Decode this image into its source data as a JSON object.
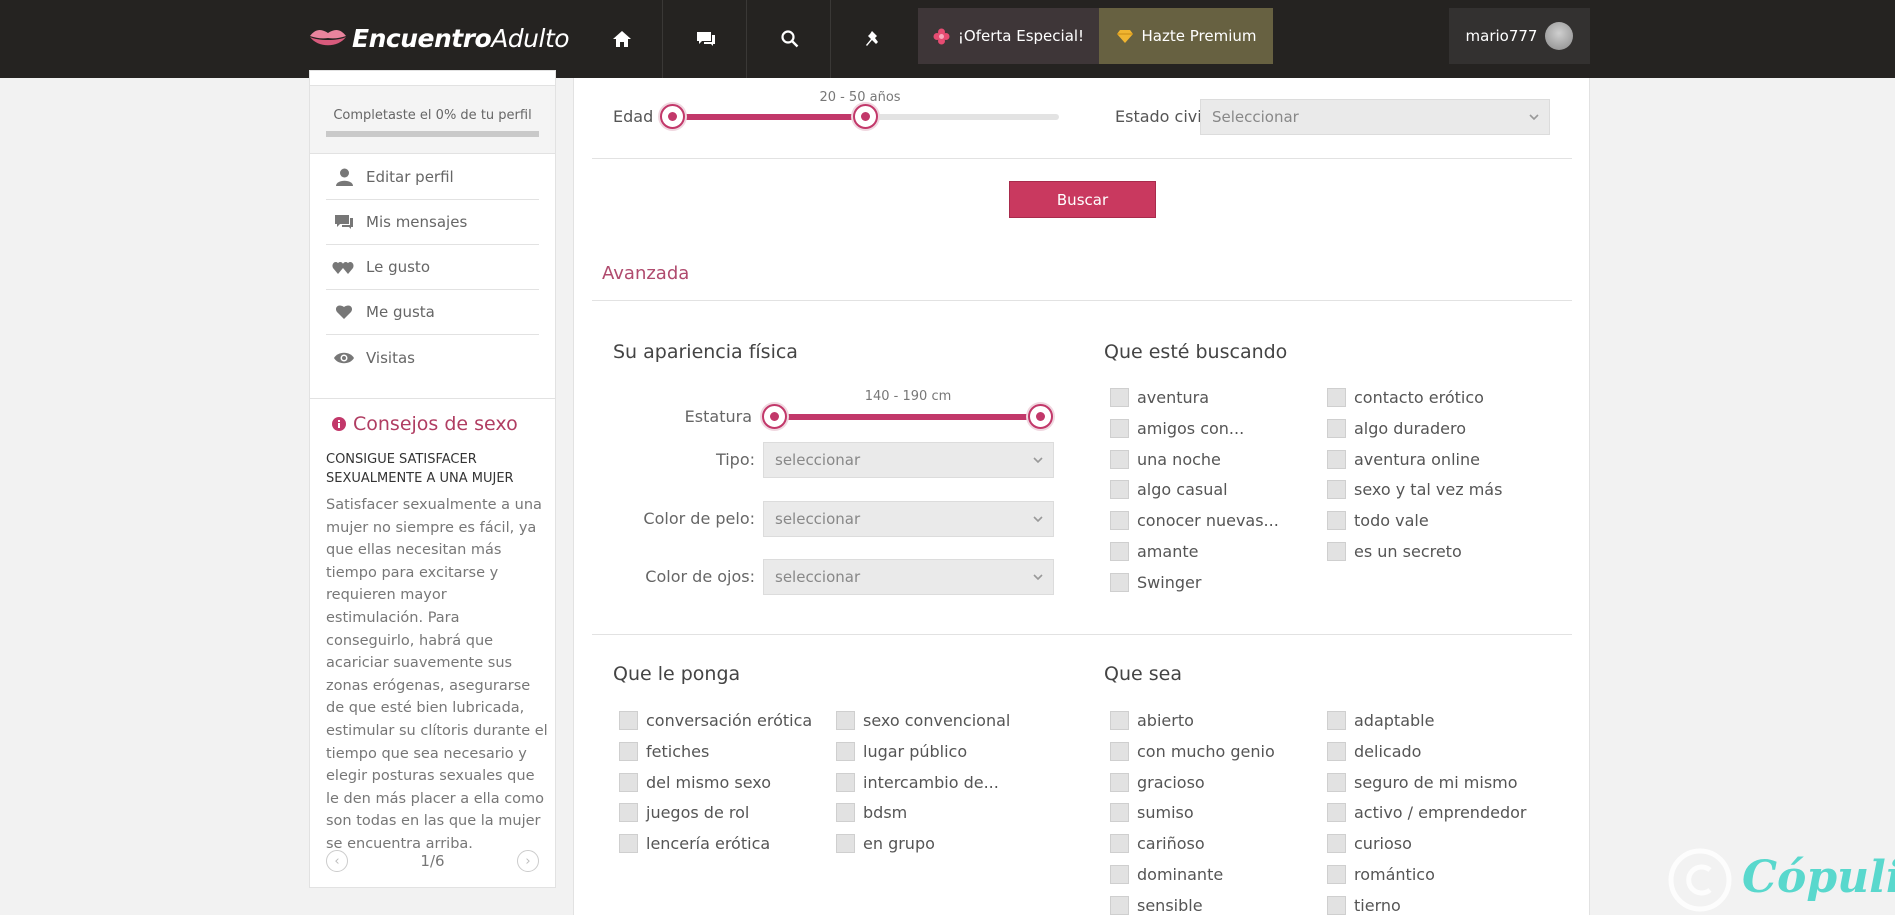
{
  "header": {
    "logo_bold": "Encuentro",
    "logo_light": "Adulto",
    "nav_icons": [
      "home-icon",
      "messages-icon",
      "search-icon",
      "pin-icon"
    ],
    "oferta_label": "¡Oferta Especial!",
    "premium_label": "Hazte Premium",
    "username": "mario777"
  },
  "sidebar": {
    "profile_progress_text": "Completaste el 0% de tu perfil",
    "profile_progress_fraction": 0,
    "menu": [
      {
        "label": "Editar perfil",
        "icon": "user-icon"
      },
      {
        "label": "Mis mensajes",
        "icon": "messages-icon"
      },
      {
        "label": "Le gusto",
        "icon": "hearts-icon"
      },
      {
        "label": "Me gusta",
        "icon": "heart-icon"
      },
      {
        "label": "Visitas",
        "icon": "eye-icon"
      }
    ],
    "tips": {
      "title": "Consejos de sexo",
      "heading": "CONSIGUE SATISFACER SEXUALMENTE A UNA MUJER",
      "body": "Satisfacer sexualmente a una mujer no siempre es fácil, ya que ellas necesitan más tiempo para excitarse y requieren mayor estimulación. Para conseguirlo, habrá que acariciar suavemente sus zonas erógenas, asegurarse de que esté bien lubricada, estimular su clítoris durante el tiempo que sea necesario y elegir posturas sexuales que le den más placer a ella como son todas en las que la mujer se encuentra arriba.",
      "pager": "1/6"
    }
  },
  "search": {
    "edad_label": "Edad",
    "edad_value": "20 - 50 años",
    "edad_min": 20,
    "edad_max": 50,
    "estado_civil_label": "Estado civil",
    "estado_civil_value": "Seleccionar",
    "buscar_label": "Buscar",
    "avanzada_label": "Avanzada"
  },
  "apariencia": {
    "title": "Su apariencia física",
    "estatura_label": "Estatura",
    "estatura_value": "140 - 190 cm",
    "estatura_min": 140,
    "estatura_max": 190,
    "tipo_label": "Tipo:",
    "tipo_value": "seleccionar",
    "pelo_label": "Color de pelo:",
    "pelo_value": "seleccionar",
    "ojos_label": "Color de ojos:",
    "ojos_value": "seleccionar"
  },
  "buscando": {
    "title": "Que esté buscando",
    "col1": [
      "aventura",
      "amigos con...",
      "una noche",
      "algo casual",
      "conocer nuevas...",
      "amante",
      "Swinger"
    ],
    "col2": [
      "contacto erótico",
      "algo duradero",
      "aventura online",
      "sexo y tal vez más",
      "todo vale",
      "es un secreto"
    ]
  },
  "ponga": {
    "title": "Que le ponga",
    "col1": [
      "conversación erótica",
      "fetiches",
      "del mismo sexo",
      "juegos de rol",
      "lencería erótica"
    ],
    "col2": [
      "sexo convencional",
      "lugar público",
      "intercambio de...",
      "bdsm",
      "en grupo"
    ]
  },
  "sea": {
    "title": "Que sea",
    "col1": [
      "abierto",
      "con mucho genio",
      "gracioso",
      "sumiso",
      "cariñoso",
      "dominante",
      "sensible"
    ],
    "col2": [
      "adaptable",
      "delicado",
      "seguro de mi mismo",
      "activo / emprendedor",
      "curioso",
      "romántico",
      "tierno"
    ]
  },
  "watermark": "Cópuli",
  "colors": {
    "accent": "#c9395f",
    "topbar": "#252321",
    "premium": "#676141"
  }
}
